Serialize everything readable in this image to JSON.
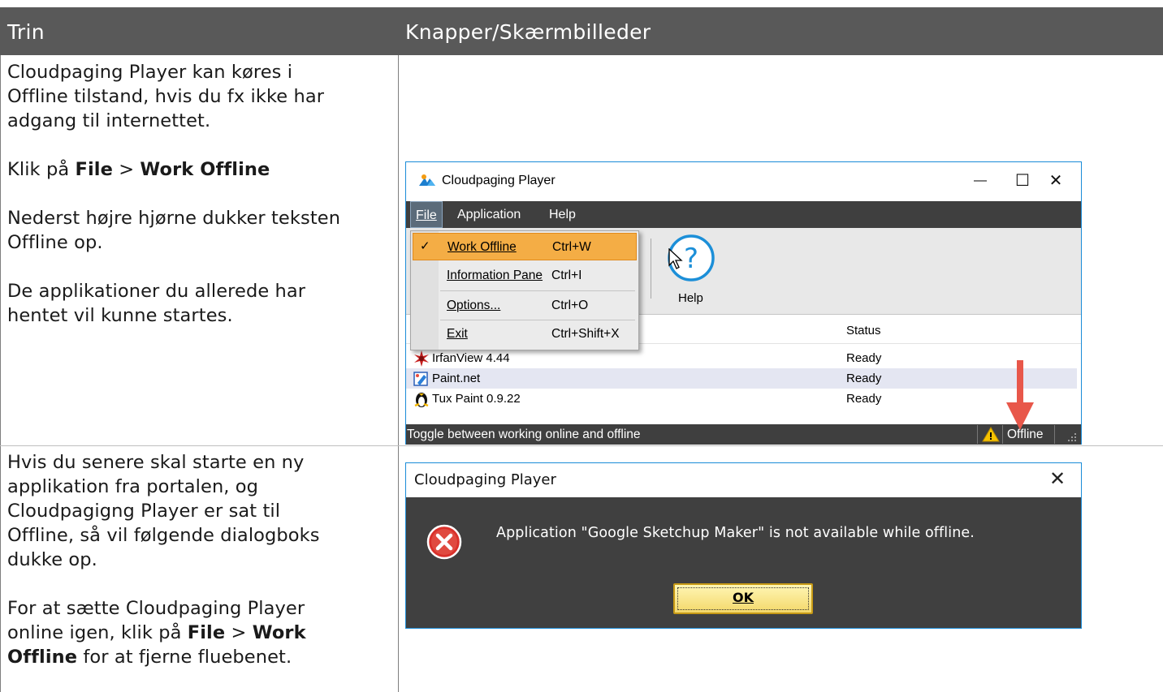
{
  "table": {
    "header": {
      "col1": "Trin",
      "col2": "Knapper/Skærmbilleder"
    },
    "row1": {
      "p1_l1": "Cloudpaging Player kan køres i",
      "p1_l2": "Offline tilstand, hvis du fx ikke har",
      "p1_l3": "adgang til internettet.",
      "p2_prefix": "Klik på ",
      "p2_b1": "File",
      "p2_mid": " > ",
      "p2_b2": "Work Offline",
      "p3_l1": "Nederst højre hjørne dukker teksten",
      "p3_l2": "Offline op.",
      "p4_l1": "De applikationer du allerede har",
      "p4_l2": "hentet vil kunne startes."
    },
    "row2": {
      "p1_l1": "Hvis du senere skal starte en ny",
      "p1_l2": "applikation fra portalen, og",
      "p1_l3": "Cloudpagigng Player er sat til",
      "p1_l4": "Offline, så vil følgende dialogboks",
      "p1_l5": "dukke op.",
      "p2_l1": "For at sætte Cloudpaging Player",
      "p2_l2_prefix": "online igen, klik på ",
      "p2_l2_b1": "File",
      "p2_l2_mid": " > ",
      "p2_l2_b2": "Work",
      "p2_l3_b": "Offline",
      "p2_l3_rest": " for at fjerne fluebenet."
    }
  },
  "player_window": {
    "title": "Cloudpaging Player",
    "controls": {
      "minimize": "—",
      "maximize": "☐",
      "close": "✕"
    },
    "menubar": [
      "File",
      "Application",
      "Help"
    ],
    "toolbar_help_label": "Help",
    "help_icon_glyph": "?",
    "list_status_header": "Status",
    "apps": [
      {
        "name": "IrfanView 4.44",
        "status": "Ready"
      },
      {
        "name": "Paint.net",
        "status": "Ready"
      },
      {
        "name": "Tux Paint 0.9.22",
        "status": "Ready"
      }
    ],
    "statusbar_message": "Toggle between working online and offline",
    "statusbar_mode": "Offline"
  },
  "file_menu": {
    "items": [
      {
        "label": "Work Offline",
        "shortcut": "Ctrl+W",
        "checked": true,
        "highlighted": true
      },
      {
        "label": "Information Pane",
        "shortcut": "Ctrl+I",
        "checked": false,
        "highlighted": false
      },
      {
        "label": "Options...",
        "shortcut": "Ctrl+O",
        "checked": false,
        "highlighted": false
      },
      {
        "label": "Exit",
        "shortcut": "Ctrl+Shift+X",
        "checked": false,
        "highlighted": false
      }
    ],
    "check_glyph": "✓"
  },
  "dialog": {
    "title": "Cloudpaging Player",
    "close_glyph": "✕",
    "message": "Application \"Google Sketchup Maker\" is not available while offline.",
    "ok_label": "OK"
  },
  "colors": {
    "header_bg": "#595959",
    "menu_highlight": "#f4ad45",
    "accent_blue": "#1a8cd8",
    "arrow_red": "#e8574a",
    "ok_button": "#f3d86a"
  }
}
